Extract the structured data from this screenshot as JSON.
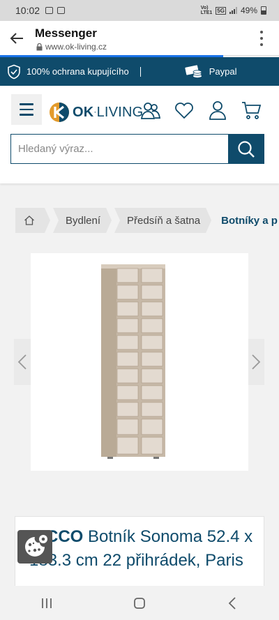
{
  "status_bar": {
    "time": "10:02",
    "network_top": "Vo)",
    "network_bottom": "LTE1",
    "network_type": "5G",
    "battery": "49%"
  },
  "browser": {
    "app_title": "Messenger",
    "url": "www.ok-living.cz"
  },
  "trust_bar": {
    "guarantee": "100% ochrana kupujícího",
    "payment": "Paypal"
  },
  "header": {
    "logo_bold": "OK",
    "logo_light": "LIVING",
    "search_placeholder": "Hledaný výraz..."
  },
  "breadcrumb": [
    "Bydlení",
    "Předsíň a šatna",
    "Botníky a p"
  ],
  "product": {
    "brand": "NICCO",
    "title": " Botník Sonoma 52.4 x 183.3 cm 22 přihrádek, Paris"
  },
  "colors": {
    "brand_blue": "#0f4b6b",
    "logo_orange": "#e39b2c",
    "progress_blue": "#1a73e8",
    "shelf_wood": "#c7b9a8"
  },
  "icons": [
    "arrow-left-icon",
    "lock-icon",
    "more-icon",
    "shield-check-icon",
    "money-icon",
    "hamburger-icon",
    "people-icon",
    "heart-icon",
    "user-icon",
    "cart-icon",
    "search-icon",
    "home-icon",
    "chevron-left-icon",
    "chevron-right-icon",
    "cookie-icon",
    "recent-apps-icon",
    "home-nav-icon",
    "back-nav-icon"
  ]
}
